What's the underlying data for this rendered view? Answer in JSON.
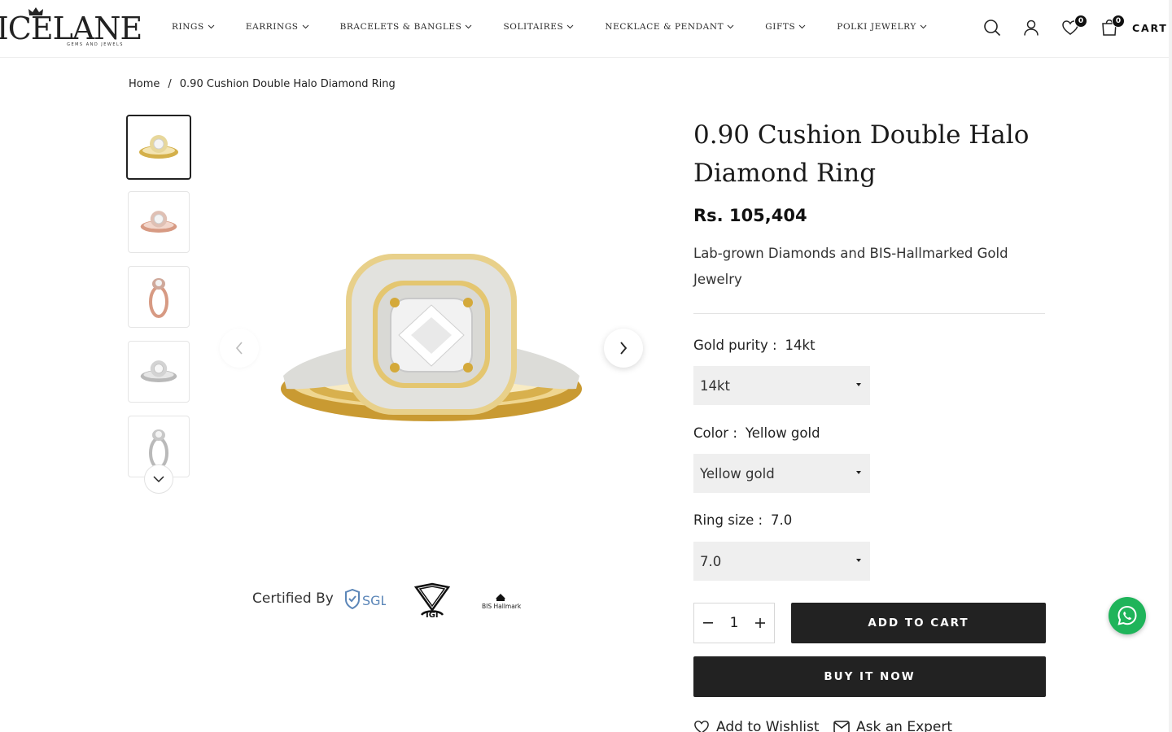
{
  "header": {
    "brand": "ICELANE",
    "brand_tagline": "GEMS AND JEWELS",
    "nav": [
      {
        "label": "RINGS"
      },
      {
        "label": "EARRINGS"
      },
      {
        "label": "BRACELETS & BANGLES"
      },
      {
        "label": "SOLITAIRES"
      },
      {
        "label": "NECKLACE & PENDANT"
      },
      {
        "label": "GIFTS"
      },
      {
        "label": "POLKI JEWELRY"
      }
    ],
    "icons": [
      "search-icon",
      "account-icon",
      "wishlist-icon",
      "cart-icon"
    ],
    "wishlist_count": "0",
    "cart_count": "0",
    "cart_label": "CART"
  },
  "breadcrumb": {
    "home": "Home",
    "separator": "/",
    "current": "0.90 Cushion Double Halo Diamond Ring"
  },
  "gallery": {
    "thumbnails": [
      {
        "metal": "yellow gold",
        "view": "top",
        "color": "#d4b04a"
      },
      {
        "metal": "rose gold",
        "view": "top",
        "color": "#d79a83"
      },
      {
        "metal": "rose gold",
        "view": "side",
        "color": "#d79a83"
      },
      {
        "metal": "white gold",
        "view": "top",
        "color": "#b9b9b9"
      },
      {
        "metal": "white gold",
        "view": "side",
        "color": "#b9b9b9"
      }
    ],
    "selected_index": 0
  },
  "certified": {
    "label": "Certified By",
    "logos": [
      "SGL",
      "IGI",
      "BIS Hallmark"
    ]
  },
  "product": {
    "title": "0.90 Cushion Double Halo Diamond Ring",
    "price": "Rs. 105,404",
    "description": "Lab-grown Diamonds and BIS-Hallmarked Gold Jewelry",
    "options": {
      "gold_purity": {
        "label": "Gold purity :",
        "value": "14kt",
        "selected": "14kt"
      },
      "color": {
        "label": "Color :",
        "value": "Yellow gold",
        "selected": "Yellow gold"
      },
      "ring_size": {
        "label": "Ring size :",
        "value": "7.0",
        "selected": "7.0"
      }
    },
    "quantity": "1",
    "add_to_cart": "ADD TO CART",
    "buy_now": "BUY IT NOW",
    "add_to_wishlist": "Add to Wishlist",
    "ask_expert": "Ask an Expert"
  },
  "colors": {
    "primary_button": "#222222",
    "select_bg": "#efefef",
    "gold": "#d4b04a",
    "whatsapp": "#1fb45a"
  }
}
